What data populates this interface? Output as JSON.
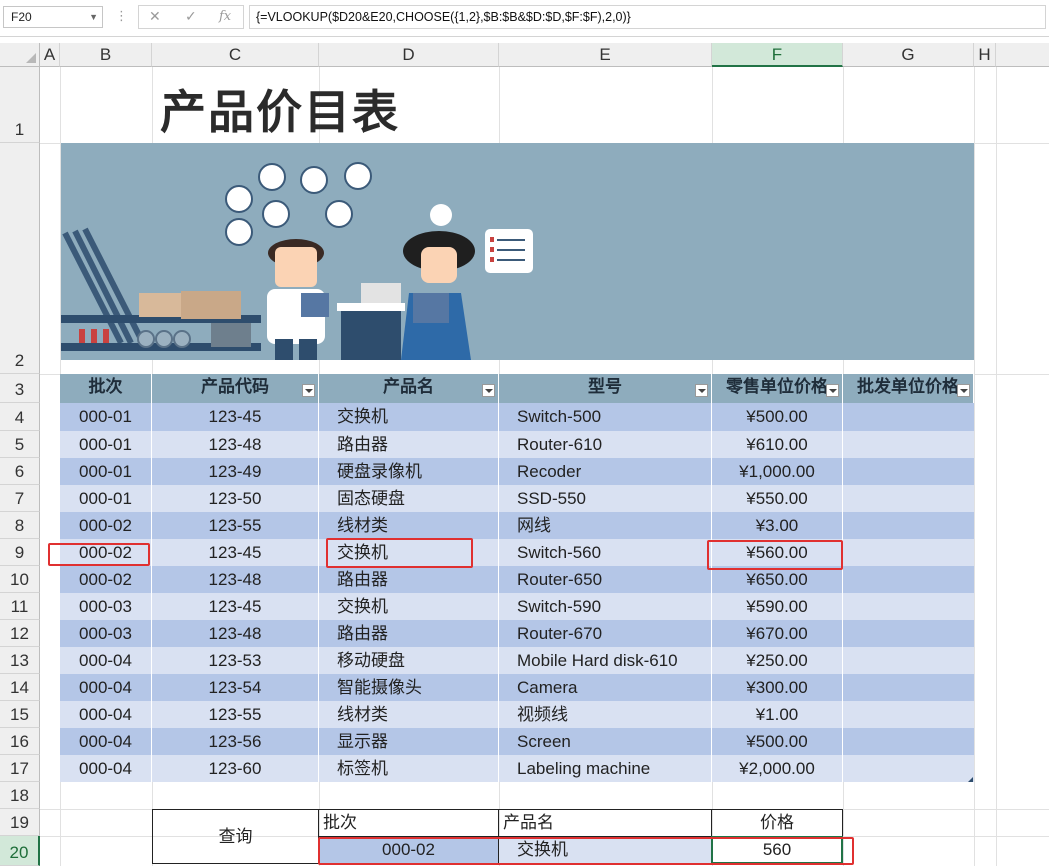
{
  "formula_bar": {
    "cell_ref": "F20",
    "formula": "{=VLOOKUP($D20&E20,CHOOSE({1,2},$B:$B&$D:$D,$F:$F),2,0)}"
  },
  "columns": [
    "A",
    "B",
    "C",
    "D",
    "E",
    "F",
    "G",
    "H"
  ],
  "rows": [
    "1",
    "2",
    "3",
    "4",
    "5",
    "6",
    "7",
    "8",
    "9",
    "10",
    "11",
    "12",
    "13",
    "14",
    "15",
    "16",
    "17",
    "18",
    "19",
    "20"
  ],
  "title": "产品价目表",
  "headers": [
    "批次",
    "产品代码",
    "产品名",
    "型号",
    "零售单位价格",
    "批发单位价格"
  ],
  "table": [
    [
      "000-01",
      "123-45",
      "交换机",
      "Switch-500",
      "¥500.00"
    ],
    [
      "000-01",
      "123-48",
      "路由器",
      "Router-610",
      "¥610.00"
    ],
    [
      "000-01",
      "123-49",
      "硬盘录像机",
      "Recoder",
      "¥1,000.00"
    ],
    [
      "000-01",
      "123-50",
      "固态硬盘",
      "SSD-550",
      "¥550.00"
    ],
    [
      "000-02",
      "123-55",
      "线材类",
      "网线",
      "¥3.00"
    ],
    [
      "000-02",
      "123-45",
      "交换机",
      "Switch-560",
      "¥560.00"
    ],
    [
      "000-02",
      "123-48",
      "路由器",
      "Router-650",
      "¥650.00"
    ],
    [
      "000-03",
      "123-45",
      "交换机",
      "Switch-590",
      "¥590.00"
    ],
    [
      "000-03",
      "123-48",
      "路由器",
      "Router-670",
      "¥670.00"
    ],
    [
      "000-04",
      "123-53",
      "移动硬盘",
      "Mobile Hard disk-610",
      "¥250.00"
    ],
    [
      "000-04",
      "123-54",
      "智能摄像头",
      "Camera",
      "¥300.00"
    ],
    [
      "000-04",
      "123-55",
      "线材类",
      "视频线",
      "¥1.00"
    ],
    [
      "000-04",
      "123-56",
      "显示器",
      "Screen",
      "¥500.00"
    ],
    [
      "000-04",
      "123-60",
      "标签机",
      "Labeling machine",
      "¥2,000.00"
    ]
  ],
  "query": {
    "label": "查询",
    "h_batch": "批次",
    "h_name": "产品名",
    "h_price": "价格",
    "v_batch": "000-02",
    "v_name": "交换机",
    "v_price": "560"
  },
  "colors": {
    "header": "#8eacbd",
    "row_dark": "#b4c6e7",
    "row_light": "#d9e1f2",
    "highlight": "#e03030",
    "selection": "#217346"
  }
}
